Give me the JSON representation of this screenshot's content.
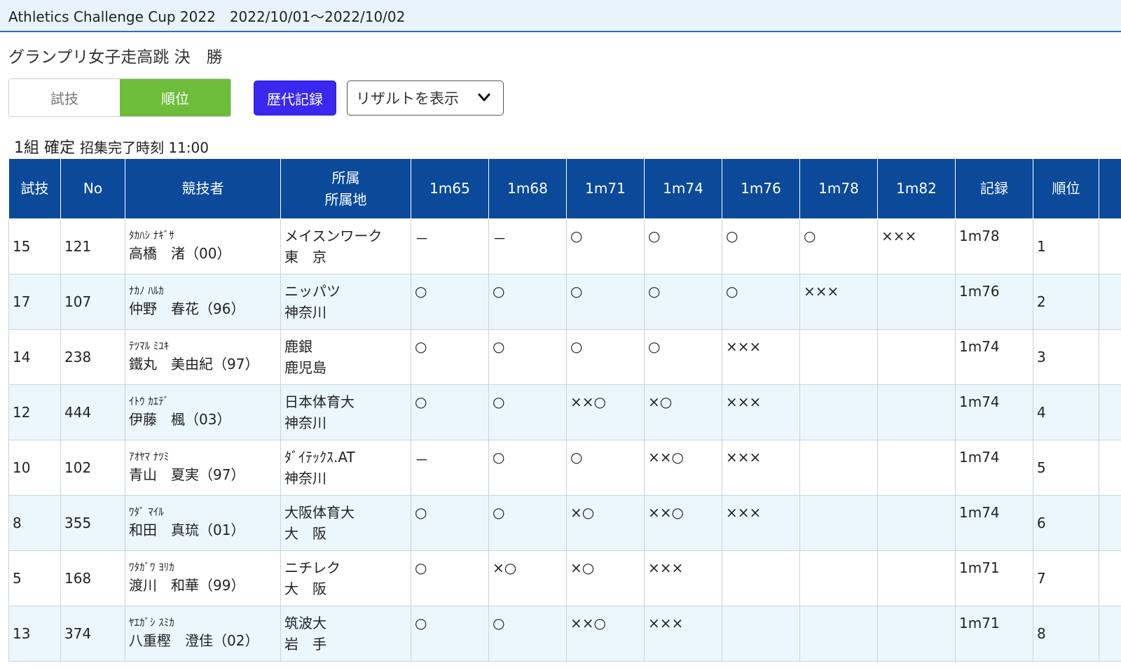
{
  "header": {
    "title": "Athletics Challenge Cup 2022　2022/10/01～2022/10/02"
  },
  "event_title": "グランプリ女子走高跳 決　勝",
  "toggle": {
    "trial_label": "試技",
    "rank_label": "順位"
  },
  "history_button": "歴代記録",
  "result_select": {
    "value": "リザルトを表示"
  },
  "group": {
    "label": "1組 確定",
    "call_time": "招集完了時刻 11:00"
  },
  "table": {
    "headers": {
      "trial": "試技",
      "no": "No",
      "athlete": "競技者",
      "affiliation": "所属",
      "region": "所属地",
      "record": "記録",
      "rank": "順位"
    },
    "heights": [
      "1m65",
      "1m68",
      "1m71",
      "1m74",
      "1m76",
      "1m78",
      "1m82"
    ],
    "rows": [
      {
        "trial": "15",
        "no": "121",
        "kana": "ﾀｶﾊｼ ﾅｷﾞｻ",
        "name": "高橋　渚（00）",
        "aff": "メイスンワーク",
        "region": "東　京",
        "attempts": [
          "－",
          "－",
          "○",
          "○",
          "○",
          "○",
          "×××"
        ],
        "record": "1m78",
        "rank": "1"
      },
      {
        "trial": "17",
        "no": "107",
        "kana": "ﾅｶﾉ ﾊﾙｶ",
        "name": "仲野　春花（96）",
        "aff": "ニッパツ",
        "region": "神奈川",
        "attempts": [
          "○",
          "○",
          "○",
          "○",
          "○",
          "×××",
          ""
        ],
        "record": "1m76",
        "rank": "2"
      },
      {
        "trial": "14",
        "no": "238",
        "kana": "ﾃﾂﾏﾙ ﾐﾕｷ",
        "name": "鐵丸　美由紀（97）",
        "aff": "鹿銀",
        "region": "鹿児島",
        "attempts": [
          "○",
          "○",
          "○",
          "○",
          "×××",
          "",
          ""
        ],
        "record": "1m74",
        "rank": "3"
      },
      {
        "trial": "12",
        "no": "444",
        "kana": "ｲﾄｳ ｶｴﾃﾞ",
        "name": "伊藤　楓（03）",
        "aff": "日本体育大",
        "region": "神奈川",
        "attempts": [
          "○",
          "○",
          "××○",
          "×○",
          "×××",
          "",
          ""
        ],
        "record": "1m74",
        "rank": "4"
      },
      {
        "trial": "10",
        "no": "102",
        "kana": "ｱｵﾔﾏ ﾅﾂﾐ",
        "name": "青山　夏実（97）",
        "aff": "ﾀﾞｲﾃｯｸｽ.AT",
        "region": "神奈川",
        "attempts": [
          "－",
          "○",
          "○",
          "××○",
          "×××",
          "",
          ""
        ],
        "record": "1m74",
        "rank": "5"
      },
      {
        "trial": "8",
        "no": "355",
        "kana": "ﾜﾀﾞ ﾏｲﾙ",
        "name": "和田　真琉（01）",
        "aff": "大阪体育大",
        "region": "大　阪",
        "attempts": [
          "○",
          "○",
          "×○",
          "××○",
          "×××",
          "",
          ""
        ],
        "record": "1m74",
        "rank": "6"
      },
      {
        "trial": "5",
        "no": "168",
        "kana": "ﾜﾀｶﾞﾜ ﾖﾘｶ",
        "name": "渡川　和華（99）",
        "aff": "ニチレク",
        "region": "大　阪",
        "attempts": [
          "○",
          "×○",
          "×○",
          "×××",
          "",
          "",
          ""
        ],
        "record": "1m71",
        "rank": "7"
      },
      {
        "trial": "13",
        "no": "374",
        "kana": "ﾔｴｶﾞｼ ｽﾐｶ",
        "name": "八重樫　澄佳（02）",
        "aff": "筑波大",
        "region": "岩　手",
        "attempts": [
          "○",
          "○",
          "××○",
          "×××",
          "",
          "",
          ""
        ],
        "record": "1m71",
        "rank": "8"
      }
    ]
  },
  "colors": {
    "header_bg": "#0b4a9a",
    "rank_on": "#6dbd3b",
    "history_btn": "#3a28f0",
    "row_alt": "#ebf7fc"
  },
  "icons": {
    "select_chevron": "chevron-down-icon"
  }
}
